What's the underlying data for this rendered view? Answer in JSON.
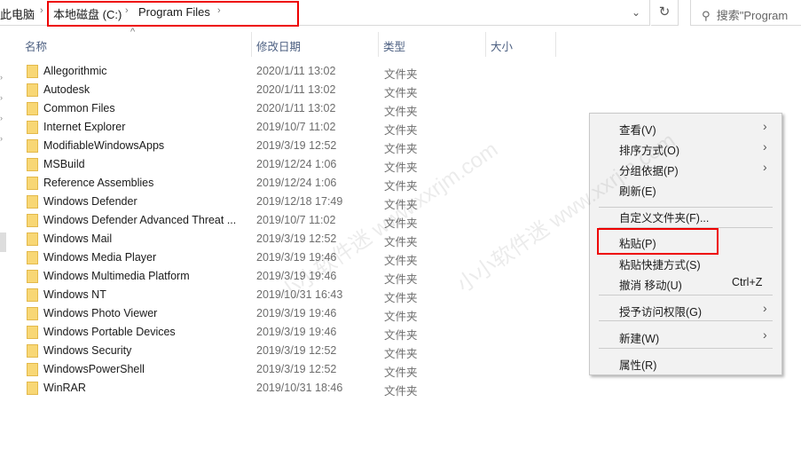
{
  "breadcrumb": {
    "items": [
      "此电脑",
      "本地磁盘 (C:)",
      "Program Files"
    ]
  },
  "search": {
    "placeholder": "搜索\"Program"
  },
  "columns": {
    "name": "名称",
    "date": "修改日期",
    "type": "类型",
    "size": "大小"
  },
  "files": [
    {
      "name": "Allegorithmic",
      "date": "2020/1/11 13:02",
      "type": "文件夹"
    },
    {
      "name": "Autodesk",
      "date": "2020/1/11 13:02",
      "type": "文件夹"
    },
    {
      "name": "Common Files",
      "date": "2020/1/11 13:02",
      "type": "文件夹"
    },
    {
      "name": "Internet Explorer",
      "date": "2019/10/7 11:02",
      "type": "文件夹"
    },
    {
      "name": "ModifiableWindowsApps",
      "date": "2019/3/19 12:52",
      "type": "文件夹"
    },
    {
      "name": "MSBuild",
      "date": "2019/12/24 1:06",
      "type": "文件夹"
    },
    {
      "name": "Reference Assemblies",
      "date": "2019/12/24 1:06",
      "type": "文件夹"
    },
    {
      "name": "Windows Defender",
      "date": "2019/12/18 17:49",
      "type": "文件夹"
    },
    {
      "name": "Windows Defender Advanced Threat ...",
      "date": "2019/10/7 11:02",
      "type": "文件夹"
    },
    {
      "name": "Windows Mail",
      "date": "2019/3/19 12:52",
      "type": "文件夹"
    },
    {
      "name": "Windows Media Player",
      "date": "2019/3/19 19:46",
      "type": "文件夹"
    },
    {
      "name": "Windows Multimedia Platform",
      "date": "2019/3/19 19:46",
      "type": "文件夹"
    },
    {
      "name": "Windows NT",
      "date": "2019/10/31 16:43",
      "type": "文件夹"
    },
    {
      "name": "Windows Photo Viewer",
      "date": "2019/3/19 19:46",
      "type": "文件夹"
    },
    {
      "name": "Windows Portable Devices",
      "date": "2019/3/19 19:46",
      "type": "文件夹"
    },
    {
      "name": "Windows Security",
      "date": "2019/3/19 12:52",
      "type": "文件夹"
    },
    {
      "name": "WindowsPowerShell",
      "date": "2019/3/19 12:52",
      "type": "文件夹"
    },
    {
      "name": "WinRAR",
      "date": "2019/10/31 18:46",
      "type": "文件夹"
    }
  ],
  "context_menu": {
    "items": [
      {
        "label": "查看(V)",
        "submenu": true
      },
      {
        "label": "排序方式(O)",
        "submenu": true
      },
      {
        "label": "分组依据(P)",
        "submenu": true
      },
      {
        "label": "刷新(E)"
      },
      {
        "label": "自定义文件夹(F)..."
      },
      {
        "label": "粘贴(P)",
        "highlighted": true
      },
      {
        "label": "粘贴快捷方式(S)"
      },
      {
        "label": "撤消 移动(U)",
        "shortcut": "Ctrl+Z"
      },
      {
        "label": "授予访问权限(G)",
        "submenu": true
      },
      {
        "label": "新建(W)",
        "submenu": true
      },
      {
        "label": "属性(R)"
      }
    ]
  },
  "watermark": "小小软件迷 www.xxrjm.com",
  "colors": {
    "highlight_box": "#ee0000",
    "folder": "#f8d775",
    "header_text": "#4d6082"
  }
}
